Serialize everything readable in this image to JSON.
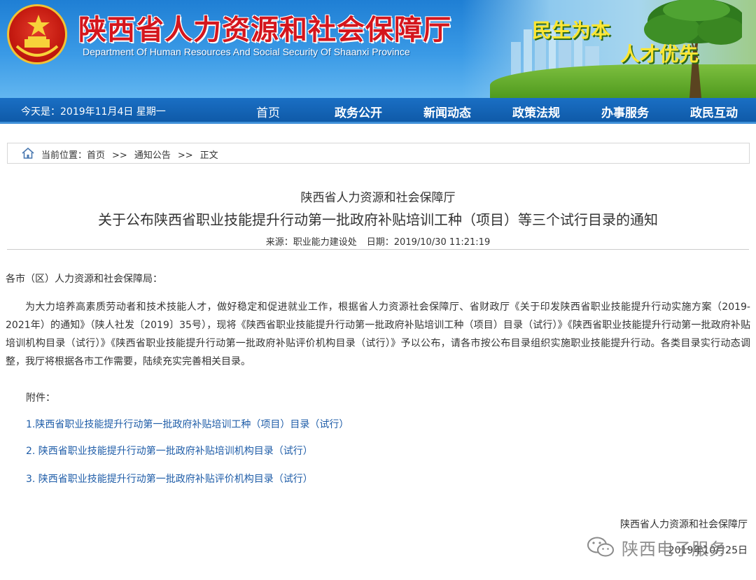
{
  "header": {
    "title_cn": "陕西省人力资源和社会保障厅",
    "title_en": "Department Of Human Resources And Social Security Of Shaanxi Province",
    "slogan_1": "民生为本",
    "slogan_2": "人才优先",
    "brand_red": "#d4161d",
    "slogan_yellow": "#ffe632"
  },
  "nav": {
    "date": "今天是：2019年11月4日 星期一",
    "items": [
      {
        "label": "首页"
      },
      {
        "label": "政务公开"
      },
      {
        "label": "新闻动态"
      },
      {
        "label": "政策法规"
      },
      {
        "label": "办事服务"
      },
      {
        "label": "政民互动"
      }
    ],
    "bg": "#1466b8"
  },
  "breadcrumb": {
    "icon": "home-icon",
    "prefix": "当前位置：",
    "items": [
      "首页",
      "通知公告",
      "正文"
    ],
    "separator": ">>"
  },
  "article": {
    "issuer": "陕西省人力资源和社会保障厅",
    "title": "关于公布陕西省职业技能提升行动第一批政府补贴培训工种（项目）等三个试行目录的通知",
    "source": "来源：职业能力建设处",
    "date": "日期：2019/10/30 11:21:19",
    "salutation": "各市（区）人力资源和社会保障局：",
    "body": "为大力培养高素质劳动者和技术技能人才，做好稳定和促进就业工作，根据省人力资源社会保障厅、省财政厅《关于印发陕西省职业技能提升行动实施方案（2019-2021年）的通知》（陕人社发〔2019〕35号），现将《陕西省职业技能提升行动第一批政府补贴培训工种（项目）目录（试行）》《陕西省职业技能提升行动第一批政府补贴培训机构目录（试行）》《陕西省职业技能提升行动第一批政府补贴评价机构目录（试行）》予以公布，请各市按公布目录组织实施职业技能提升行动。各类目录实行动态调整，我厅将根据各市工作需要，陆续充实完善相关目录。",
    "attachments_label": "附件：",
    "attachments": [
      "1.陕西省职业技能提升行动第一批政府补贴培训工种（项目）目录（试行）",
      "2. 陕西省职业技能提升行动第一批政府补贴培训机构目录（试行）",
      "3. 陕西省职业技能提升行动第一批政府补贴评价机构目录（试行）"
    ],
    "link_color": "#1f5da8",
    "sign_org": "陕西省人力资源和社会保障厅",
    "sign_date": "2019年10月25日"
  },
  "watermark": {
    "icon": "wechat-icon",
    "text": "陕西电子服务"
  }
}
